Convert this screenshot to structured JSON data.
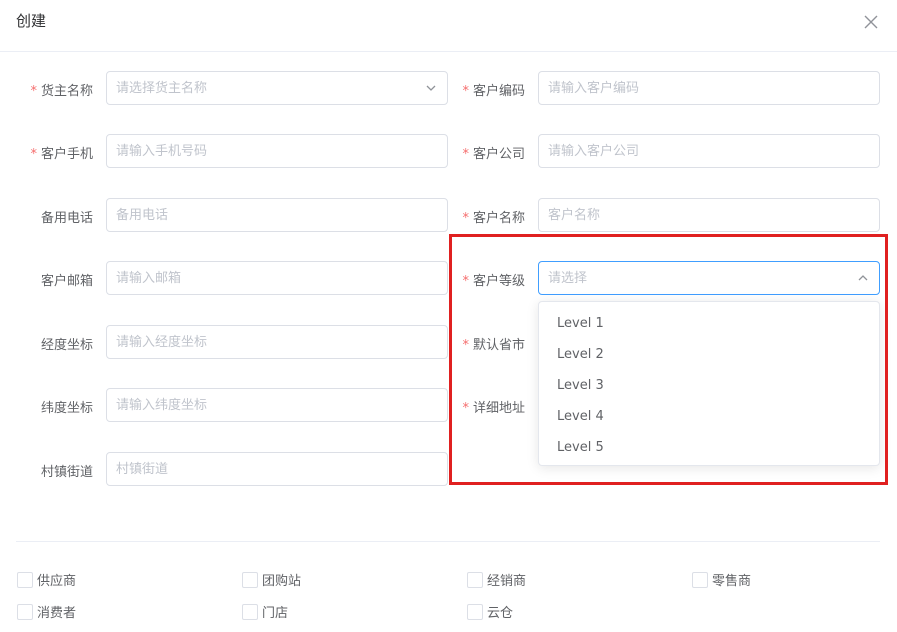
{
  "dialog": {
    "title": "创建"
  },
  "form": {
    "owner_name": {
      "label": "货主名称",
      "required": true,
      "placeholder": "请选择货主名称"
    },
    "customer_code": {
      "label": "客户编码",
      "required": true,
      "placeholder": "请输入客户编码"
    },
    "customer_phone": {
      "label": "客户手机",
      "required": true,
      "placeholder": "请输入手机号码"
    },
    "customer_company": {
      "label": "客户公司",
      "required": true,
      "placeholder": "请输入客户公司"
    },
    "backup_phone": {
      "label": "备用电话",
      "required": false,
      "placeholder": "备用电话"
    },
    "customer_name": {
      "label": "客户名称",
      "required": true,
      "placeholder": "客户名称"
    },
    "customer_email": {
      "label": "客户邮箱",
      "required": false,
      "placeholder": "请输入邮箱"
    },
    "customer_level": {
      "label": "客户等级",
      "required": true,
      "placeholder": "请选择"
    },
    "longitude": {
      "label": "经度坐标",
      "required": false,
      "placeholder": "请输入经度坐标"
    },
    "default_province": {
      "label": "默认省市",
      "required": true
    },
    "latitude": {
      "label": "纬度坐标",
      "required": false,
      "placeholder": "请输入纬度坐标"
    },
    "detail_address": {
      "label": "详细地址",
      "required": true
    },
    "village_street": {
      "label": "村镇街道",
      "required": false,
      "placeholder": "村镇街道"
    }
  },
  "level_dropdown": {
    "options": [
      "Level 1",
      "Level 2",
      "Level 3",
      "Level 4",
      "Level 5"
    ]
  },
  "customer_types": [
    "供应商",
    "团购站",
    "经销商",
    "零售商",
    "消费者",
    "门店",
    "云仓"
  ],
  "colors": {
    "required_mark": "#f56c6c",
    "focus_border": "#409eff",
    "highlight_box": "#e02020"
  }
}
